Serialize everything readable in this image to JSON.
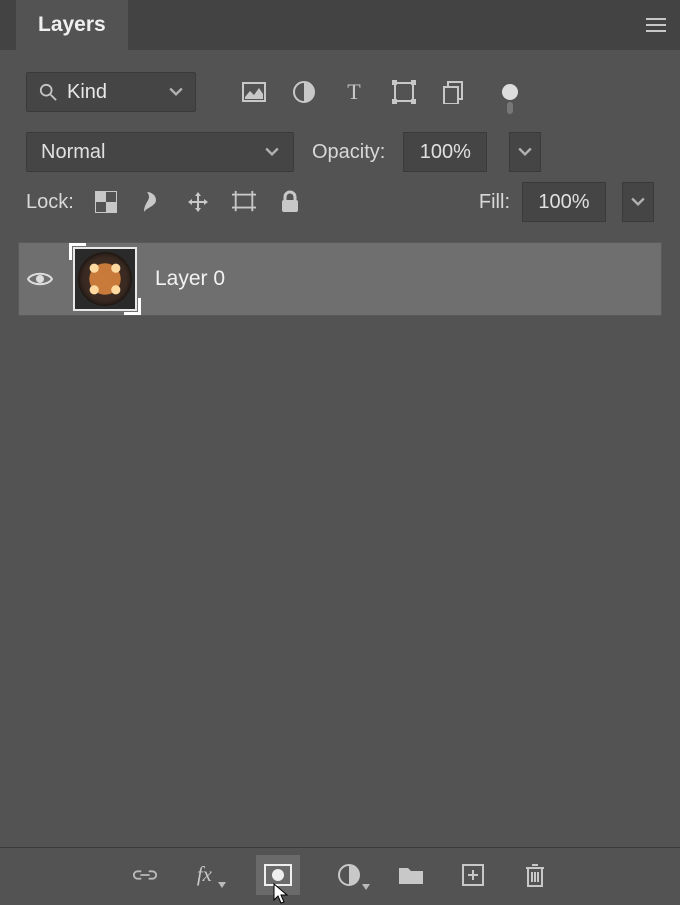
{
  "panel": {
    "title": "Layers"
  },
  "filter": {
    "label": "Kind"
  },
  "blend": {
    "mode": "Normal",
    "opacity_label": "Opacity:",
    "opacity_value": "100%"
  },
  "lock": {
    "label": "Lock:",
    "fill_label": "Fill:",
    "fill_value": "100%"
  },
  "layers": [
    {
      "name": "Layer 0",
      "visible": true
    }
  ]
}
